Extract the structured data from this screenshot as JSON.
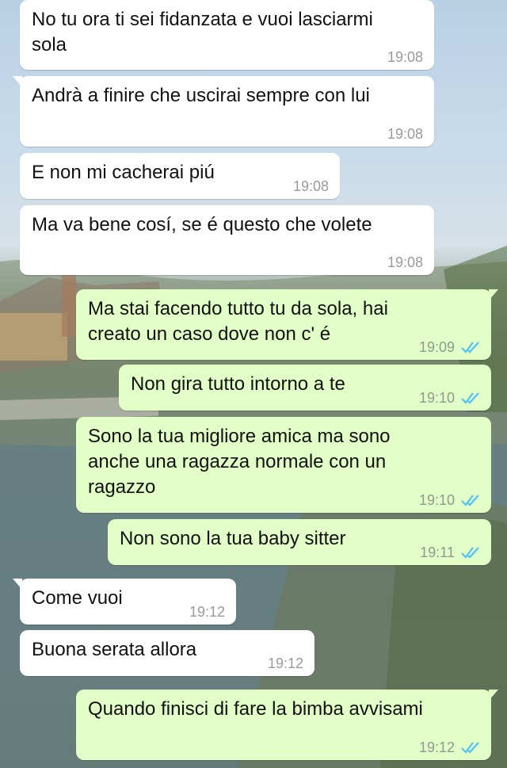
{
  "chat": {
    "messages": [
      {
        "direction": "in",
        "text": "No tu ora ti sei fidanzata e vuoi lasciarmi\nsola",
        "time": "19:08"
      },
      {
        "direction": "in",
        "text": "Andrà a finire che uscirai sempre con lui",
        "time": "19:08"
      },
      {
        "direction": "in",
        "text": "E non mi cacherai piú",
        "time": "19:08"
      },
      {
        "direction": "in",
        "text": "Ma va bene cosí, se é questo che volete",
        "time": "19:08"
      },
      {
        "direction": "out",
        "text": "Ma stai facendo tutto tu da sola, hai\ncreato un caso dove non c' é",
        "time": "19:09",
        "status": "read"
      },
      {
        "direction": "out",
        "text": "Non gira tutto intorno a te",
        "time": "19:10",
        "status": "read"
      },
      {
        "direction": "out",
        "text": "Sono la tua migliore amica ma sono\nanche una ragazza normale con un\nragazzo",
        "time": "19:10",
        "status": "read"
      },
      {
        "direction": "out",
        "text": "Non sono la tua baby sitter",
        "time": "19:11",
        "status": "read"
      },
      {
        "direction": "in",
        "text": "Come vuoi",
        "time": "19:12"
      },
      {
        "direction": "in",
        "text": "Buona serata allora",
        "time": "19:12"
      },
      {
        "direction": "out",
        "text": "Quando finisci di fare la bimba avvisami",
        "time": "19:12",
        "status": "read"
      }
    ]
  },
  "colors": {
    "incoming_bubble": "#ffffff",
    "outgoing_bubble": "#e1ffc7",
    "read_ticks": "#4fc3f7"
  },
  "icons": {
    "read_status": "double-check-icon"
  }
}
